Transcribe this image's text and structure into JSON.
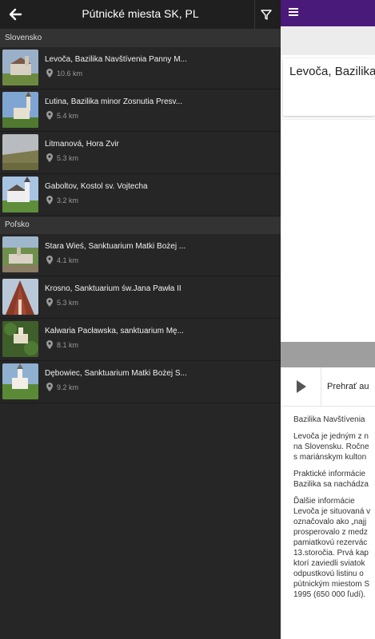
{
  "drawer": {
    "title": "Pútnické miesta SK, PL",
    "sections": [
      {
        "label": "Slovensko",
        "items": [
          {
            "name": "Levoča, Bazilika Navštívenia Panny M...",
            "distance": "10.6 km"
          },
          {
            "name": "Ľutina, Bazilika minor Zosnutia Presv...",
            "distance": "5.4 km"
          },
          {
            "name": "Litmanová, Hora Zvir",
            "distance": "5.3 km"
          },
          {
            "name": "Gaboltov, Kostol sv. Vojtecha",
            "distance": "3.2 km"
          }
        ]
      },
      {
        "label": "Poľsko",
        "items": [
          {
            "name": "Stara Wieś, Sanktuarium Matki Bożej ...",
            "distance": "4.1 km"
          },
          {
            "name": "Krosno, Sanktuarium św.Jana Pawła II",
            "distance": "5.3 km"
          },
          {
            "name": "Kalwaria Pacławska, sanktuarium Mę...",
            "distance": "8.1 km"
          },
          {
            "name": "Dębowiec, Sanktuarium Matki Bożej S...",
            "distance": "9.2 km"
          }
        ]
      }
    ]
  },
  "content": {
    "header_title": "Levoča, Bazilika",
    "play_label": "Prehrať au",
    "desc": [
      "Bazilika Navštívenia",
      "Levoča je jedným z n",
      "na Slovensku. Ročne",
      "s mariánskym kulton",
      "Praktické informácie",
      "Bazilika sa nachádza",
      "Ďalšie informácie",
      "Levoča je situovaná v",
      "označovalo ako „najj",
      "prosperovalo z medz",
      "pamiatkovú rezervác",
      "13.storočia.  Prvá kap",
      "ktorí zaviedli sviatok",
      "odpustkovú listinu o",
      "pútnickým miestom S",
      "1995 (650 000 ľudí)."
    ]
  },
  "colors": {
    "appbar": "#4a1a7a",
    "drawer_bg": "#262626"
  }
}
